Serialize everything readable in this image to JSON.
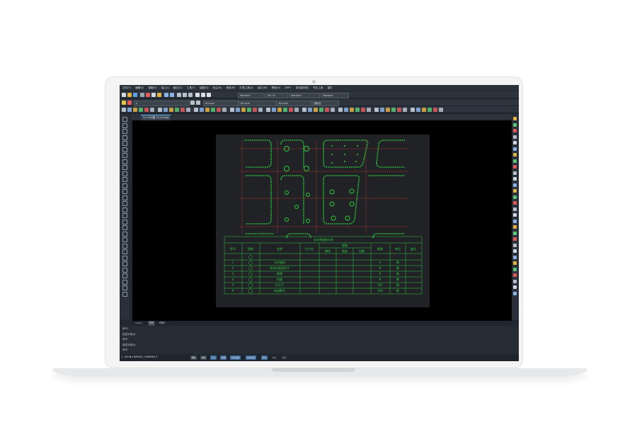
{
  "menubar": [
    "文件(F)",
    "编辑(E)",
    "视图(V)",
    "插入(I)",
    "格式(O)",
    "工具(T)",
    "绘图(D)",
    "标注(N)",
    "修改(M)",
    "扩展工具(X)",
    "窗口(W)",
    "帮助(H)",
    "APP+",
    "新功能特性",
    "专业工具",
    "插件"
  ],
  "toolbar": {
    "layer_combo": "0",
    "text_style": "Standard",
    "dim_style": "ISO-25",
    "table_style": "Standard",
    "bylayer_color": "ByLayer",
    "linetype": "ByLayer",
    "lineweight": "ByLayer",
    "plot_style": "随颜色",
    "layer_state": "0"
  },
  "document_tab": "3-1 CAD图 13-12.dwg",
  "model_tabs": [
    "模型",
    "布局1"
  ],
  "command_lines": [
    "命令:",
    "指定对角点:",
    "命令:",
    "指定对角点:",
    "命令:"
  ],
  "status": {
    "coords": "1, 300 ▼   2469563, 1469869.3",
    "buttons": [
      "栅格",
      "捕捉",
      "正交",
      "极轴",
      "对象捕捉",
      "对象追踪",
      "线宽",
      "动态",
      "模型"
    ]
  },
  "table": {
    "title": "苗木数量统计表",
    "headers": [
      "序号",
      "图例",
      "名称",
      "拉丁名",
      "规格",
      "数量",
      "单位",
      "备注"
    ],
    "sub_headers": [
      "胸径",
      "高度",
      "冠幅"
    ],
    "rows": [
      {
        "no": "1",
        "name": "大叶榕树",
        "qty": "4",
        "unit": "株"
      },
      {
        "no": "2",
        "name": "条状丛植金棕子",
        "qty": "8",
        "unit": "株"
      },
      {
        "no": "3",
        "name": "紫薇",
        "qty": "6",
        "unit": "株"
      },
      {
        "no": "4",
        "name": "凤凰",
        "qty": "9",
        "unit": "株"
      },
      {
        "no": "5",
        "name": "白玉兰",
        "qty": "187",
        "unit": "株"
      },
      {
        "no": "6",
        "name": "布迪椰子",
        "qty": "194",
        "unit": "株"
      }
    ]
  },
  "colors": {
    "app_bg": "#222831",
    "canvas_bg": "#000000",
    "cad_green": "#2ecc40",
    "grid_red": "#c0392b"
  }
}
